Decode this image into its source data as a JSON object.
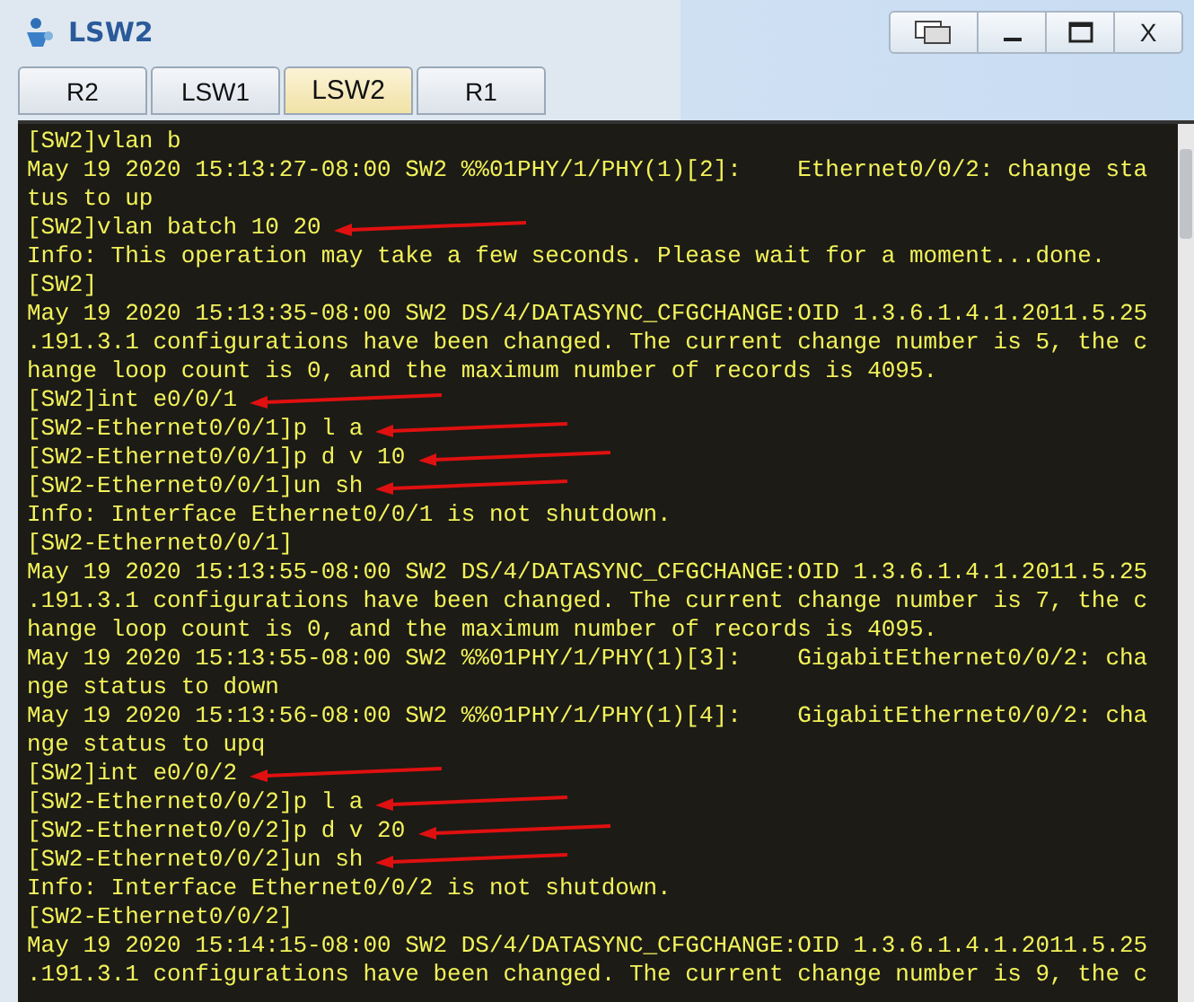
{
  "window": {
    "title": "LSW2",
    "close_label": "X"
  },
  "tabs": [
    {
      "label": "R2",
      "selected": false
    },
    {
      "label": "LSW1",
      "selected": false
    },
    {
      "label": "LSW2",
      "selected": true
    },
    {
      "label": "R1",
      "selected": false
    }
  ],
  "terminal": {
    "lines": [
      {
        "text": "[SW2]vlan b",
        "arrow": false
      },
      {
        "text": "May 19 2020 15:13:27-08:00 SW2 %%01PHY/1/PHY(1)[2]:    Ethernet0/0/2: change sta",
        "arrow": false
      },
      {
        "text": "tus to up",
        "arrow": false
      },
      {
        "text": "[SW2]vlan batch 10 20",
        "arrow": true
      },
      {
        "text": "Info: This operation may take a few seconds. Please wait for a moment...done.",
        "arrow": false
      },
      {
        "text": "[SW2]",
        "arrow": false
      },
      {
        "text": "May 19 2020 15:13:35-08:00 SW2 DS/4/DATASYNC_CFGCHANGE:OID 1.3.6.1.4.1.2011.5.25",
        "arrow": false
      },
      {
        "text": ".191.3.1 configurations have been changed. The current change number is 5, the c",
        "arrow": false
      },
      {
        "text": "hange loop count is 0, and the maximum number of records is 4095.",
        "arrow": false
      },
      {
        "text": "[SW2]int e0/0/1",
        "arrow": true
      },
      {
        "text": "[SW2-Ethernet0/0/1]p l a",
        "arrow": true
      },
      {
        "text": "[SW2-Ethernet0/0/1]p d v 10",
        "arrow": true
      },
      {
        "text": "[SW2-Ethernet0/0/1]un sh",
        "arrow": true
      },
      {
        "text": "Info: Interface Ethernet0/0/1 is not shutdown.",
        "arrow": false
      },
      {
        "text": "[SW2-Ethernet0/0/1]",
        "arrow": false
      },
      {
        "text": "May 19 2020 15:13:55-08:00 SW2 DS/4/DATASYNC_CFGCHANGE:OID 1.3.6.1.4.1.2011.5.25",
        "arrow": false
      },
      {
        "text": ".191.3.1 configurations have been changed. The current change number is 7, the c",
        "arrow": false
      },
      {
        "text": "hange loop count is 0, and the maximum number of records is 4095.",
        "arrow": false
      },
      {
        "text": "May 19 2020 15:13:55-08:00 SW2 %%01PHY/1/PHY(1)[3]:    GigabitEthernet0/0/2: cha",
        "arrow": false
      },
      {
        "text": "nge status to down",
        "arrow": false
      },
      {
        "text": "May 19 2020 15:13:56-08:00 SW2 %%01PHY/1/PHY(1)[4]:    GigabitEthernet0/0/2: cha",
        "arrow": false
      },
      {
        "text": "nge status to upq",
        "arrow": false
      },
      {
        "text": "[SW2]int e0/0/2",
        "arrow": true
      },
      {
        "text": "[SW2-Ethernet0/0/2]p l a",
        "arrow": true
      },
      {
        "text": "[SW2-Ethernet0/0/2]p d v 20",
        "arrow": true
      },
      {
        "text": "[SW2-Ethernet0/0/2]un sh",
        "arrow": true
      },
      {
        "text": "Info: Interface Ethernet0/0/2 is not shutdown.",
        "arrow": false
      },
      {
        "text": "[SW2-Ethernet0/0/2]",
        "arrow": false
      },
      {
        "text": "May 19 2020 15:14:15-08:00 SW2 DS/4/DATASYNC_CFGCHANGE:OID 1.3.6.1.4.1.2011.5.25",
        "arrow": false
      },
      {
        "text": ".191.3.1 configurations have been changed. The current change number is 9, the c",
        "arrow": false
      }
    ]
  }
}
